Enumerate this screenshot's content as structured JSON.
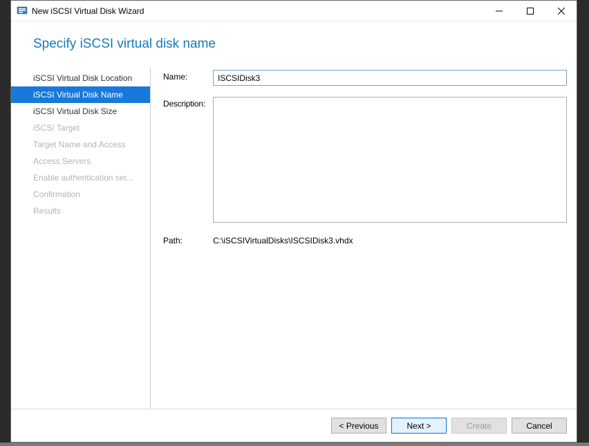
{
  "titlebar": {
    "title": "New iSCSI Virtual Disk Wizard"
  },
  "page": {
    "heading": "Specify iSCSI virtual disk name"
  },
  "sidebar": {
    "items": [
      {
        "label": "iSCSI Virtual Disk Location",
        "state": "enabled"
      },
      {
        "label": "iSCSI Virtual Disk Name",
        "state": "active"
      },
      {
        "label": "iSCSI Virtual Disk Size",
        "state": "enabled"
      },
      {
        "label": "iSCSI Target",
        "state": "disabled"
      },
      {
        "label": "Target Name and Access",
        "state": "disabled"
      },
      {
        "label": "Access Servers",
        "state": "disabled"
      },
      {
        "label": "Enable authentication ser...",
        "state": "disabled"
      },
      {
        "label": "Confirmation",
        "state": "disabled"
      },
      {
        "label": "Results",
        "state": "disabled"
      }
    ]
  },
  "form": {
    "name_label": "Name:",
    "name_value": "ISCSIDisk3",
    "description_label": "Description:",
    "description_value": "",
    "path_label": "Path:",
    "path_value": "C:\\iSCSIVirtualDisks\\ISCSIDisk3.vhdx"
  },
  "buttons": {
    "previous": "< Previous",
    "next": "Next >",
    "create": "Create",
    "cancel": "Cancel"
  }
}
